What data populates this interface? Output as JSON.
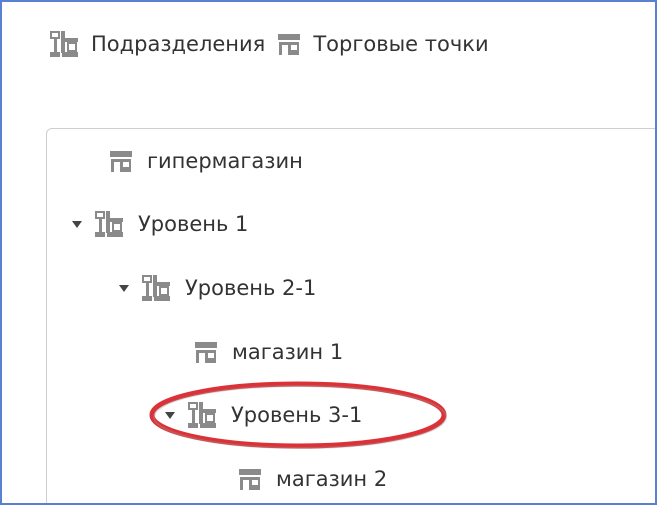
{
  "toolbar": {
    "divisions_label": "Подразделения",
    "outlets_label": "Торговые точки"
  },
  "tree": {
    "items": [
      {
        "label": "гипермагазин",
        "type": "store",
        "expanded": false
      },
      {
        "label": "Уровень 1",
        "type": "division",
        "expanded": true
      },
      {
        "label": "Уровень 2-1",
        "type": "division",
        "expanded": true
      },
      {
        "label": "магазин 1",
        "type": "store",
        "expanded": false
      },
      {
        "label": "Уровень 3-1",
        "type": "division",
        "expanded": true,
        "highlighted": true
      },
      {
        "label": "магазин 2",
        "type": "store",
        "expanded": false
      }
    ]
  },
  "icons": {
    "division": "org-structure-icon",
    "store": "storefront-icon",
    "expanded": "caret-down-icon"
  },
  "colors": {
    "icon_gray": "#8a8a8a",
    "text": "#333333",
    "panel_border": "#cfcfcf",
    "frame_border": "#5b7fd1",
    "highlight": "#d9262c"
  }
}
